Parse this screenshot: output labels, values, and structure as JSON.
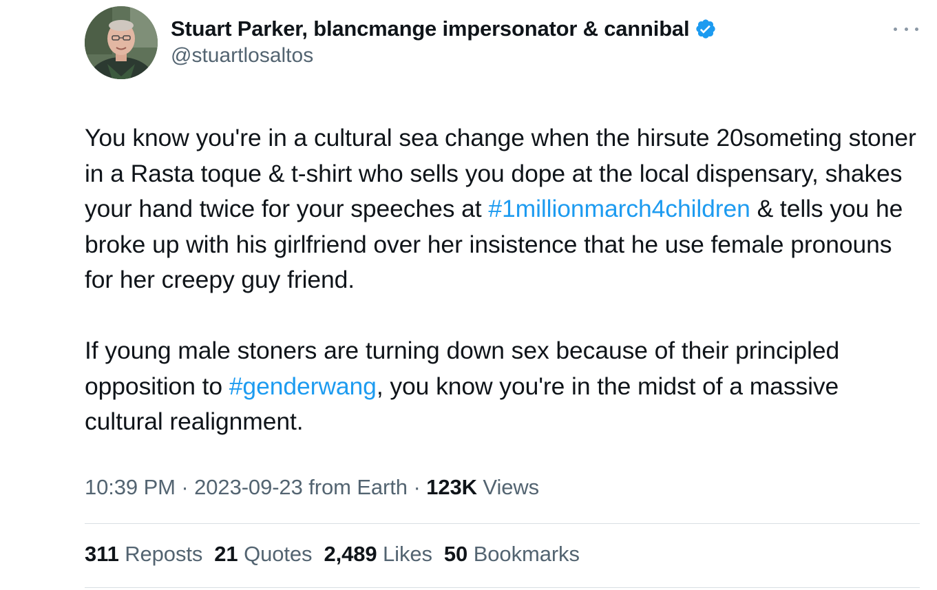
{
  "author": {
    "name": "Stuart Parker, blancmange impersonator & cannibal",
    "handle": "@stuartlosaltos",
    "verified_icon": "verified-badge-icon",
    "avatar": "profile-photo"
  },
  "more_icon": "more-horizontal-icon",
  "tweet": {
    "p1_part1": "You know you're in a cultural sea change when the hirsute 20someting stoner in a Rasta toque & t-shirt who sells you dope at the local dispensary, shakes your hand twice for your speeches at ",
    "p1_hashtag": "#1millionmarch4children",
    "p1_part2": " & tells you he broke up with his girlfriend over her insistence that he use female pronouns for her creepy guy friend.",
    "p2_part1": "If young male stoners are turning down sex because of their principled opposition to ",
    "p2_hashtag": "#genderwang",
    "p2_part2": ", you know you're in the midst of a massive cultural realignment."
  },
  "meta": {
    "time": "10:39 PM",
    "sep1": " · ",
    "date": "2023-09-23",
    "source": " from Earth",
    "sep2": " · ",
    "views_count": "123K",
    "views_label": " Views"
  },
  "stats": {
    "reposts_count": "311",
    "reposts_label": " Reposts",
    "quotes_count": "21",
    "quotes_label": " Quotes",
    "likes_count": "2,489",
    "likes_label": " Likes",
    "bookmarks_count": "50",
    "bookmarks_label": " Bookmarks"
  },
  "colors": {
    "text": "#0f1419",
    "secondary": "#536471",
    "accent": "#1d9bf0",
    "divider": "#d8dee3"
  }
}
